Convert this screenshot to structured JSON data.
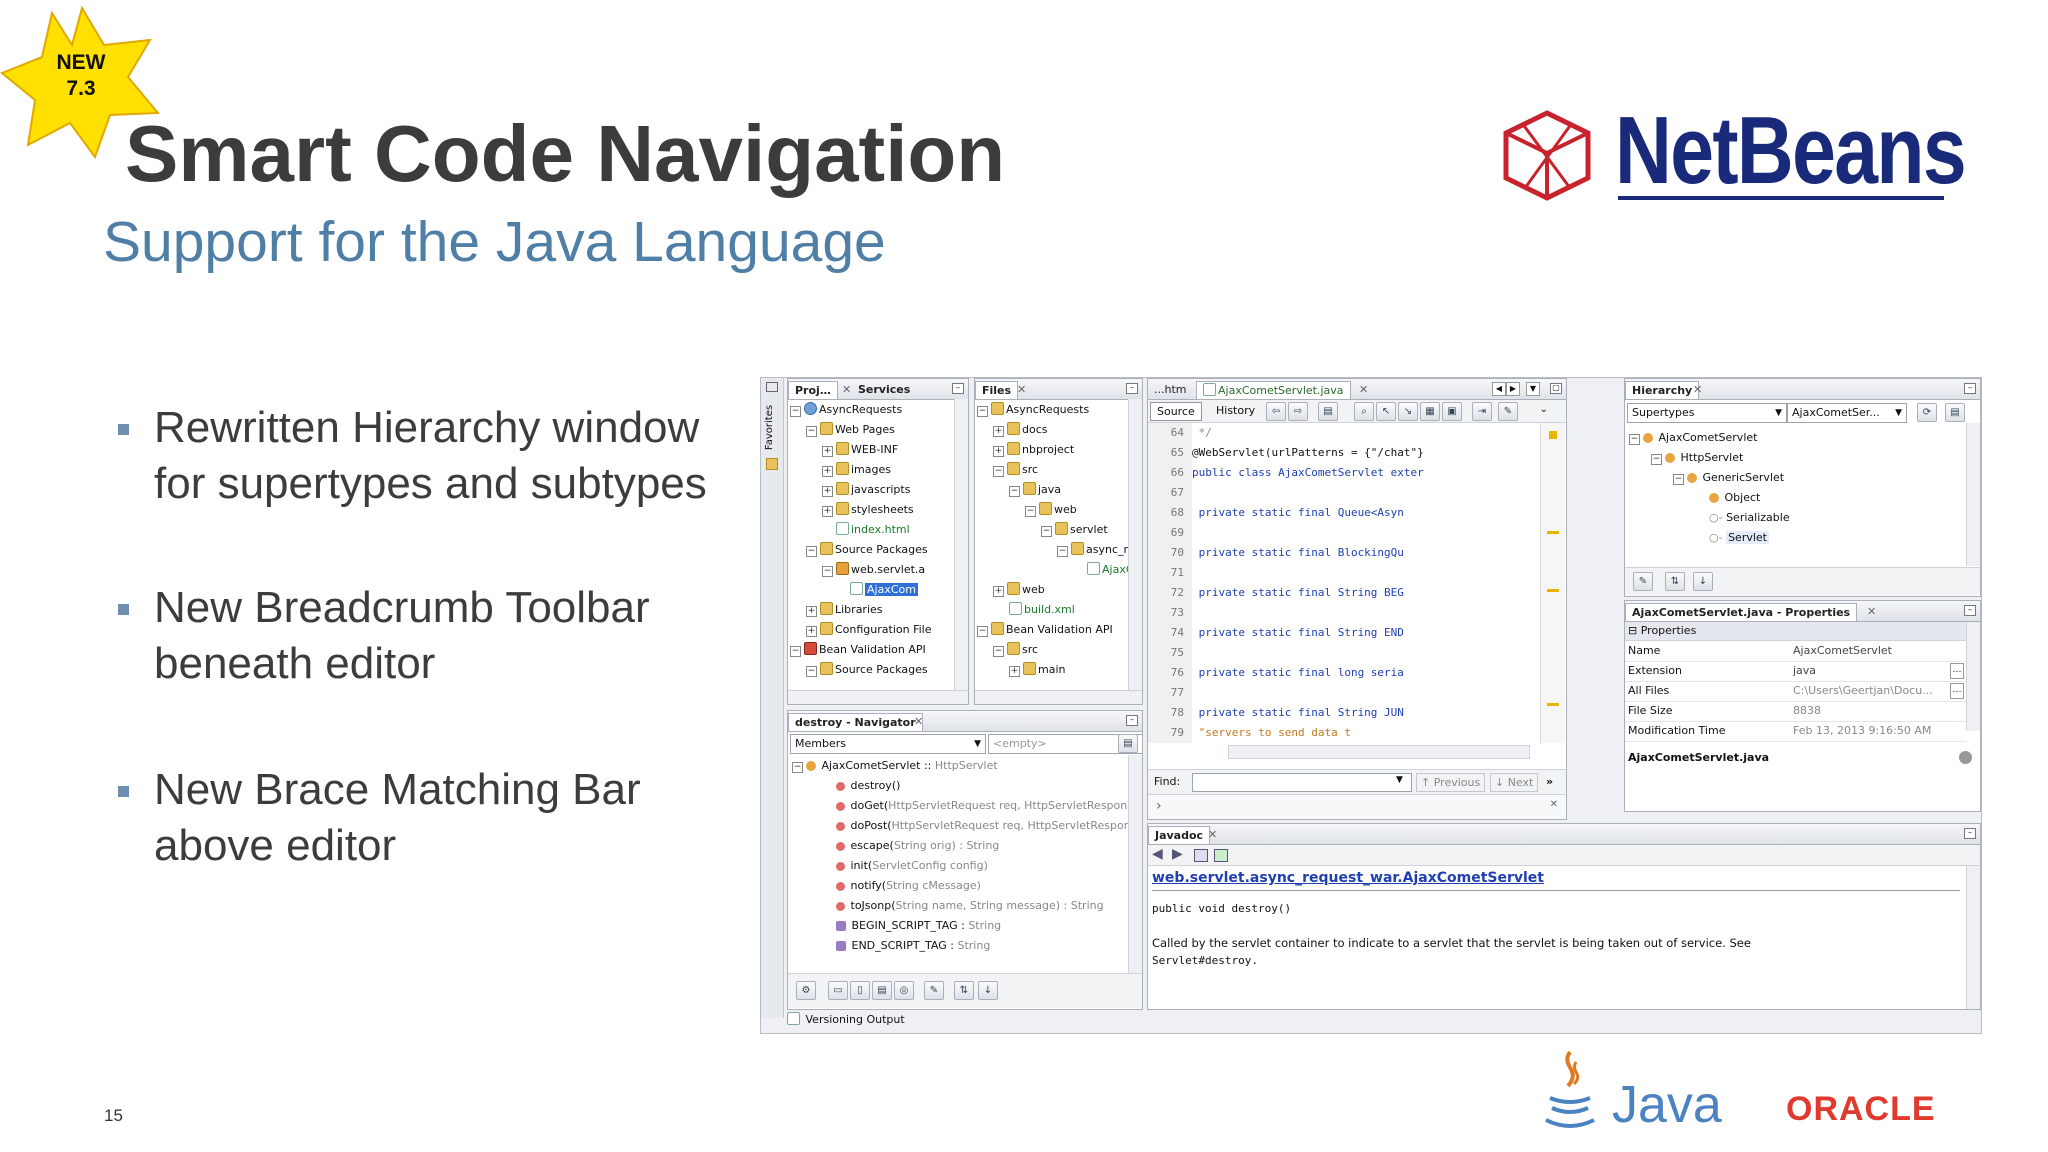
{
  "badge": {
    "line1": "NEW",
    "line2": "7.3"
  },
  "title": "Smart Code Navigation",
  "subtitle": "Support for the Java Language",
  "bullets": [
    {
      "line1": "Rewritten Hierarchy window",
      "line2": "for supertypes and subtypes"
    },
    {
      "line1": "New Breadcrumb Toolbar",
      "line2": "beneath editor"
    },
    {
      "line1": "New Brace Matching Bar",
      "line2": "above editor"
    }
  ],
  "slide_number": "15",
  "logos": {
    "netbeans": "NetBeans",
    "java": "Java",
    "oracle": "ORACLE"
  },
  "colors": {
    "title": "#3c3c3c",
    "subtitle": "#4f7fa6",
    "netbeans": "#1a2a7a",
    "oracle": "#e03a2e",
    "badge": "#ffe000"
  },
  "ide": {
    "side_label": "Favorites",
    "projects": {
      "tab1": "Proj…",
      "tab2": "Services",
      "rows": [
        "AsyncRequests",
        "Web Pages",
        "WEB-INF",
        "images",
        "javascripts",
        "stylesheets",
        "index.html",
        "Source Packages",
        "web.servlet.a",
        "AjaxCom",
        "Libraries",
        "Configuration File",
        "Bean Validation API",
        "Source Packages"
      ]
    },
    "files": {
      "tab": "Files",
      "rows": [
        "AsyncRequests",
        "docs",
        "nbproject",
        "src",
        "java",
        "web",
        "servlet",
        "async_re",
        "AjaxC",
        "web",
        "build.xml",
        "Bean Validation API",
        "src",
        "main"
      ]
    },
    "editor": {
      "tab_prev": "...htm",
      "tab_active": "AjaxCometServlet.java",
      "source_label": "Source",
      "history_label": "History",
      "lines": [
        {
          "n": "64",
          "code": "   */"
        },
        {
          "n": "65",
          "code": "@WebServlet(urlPatterns = {\"/chat\"}"
        },
        {
          "n": "66",
          "code": "public class AjaxCometServlet exter"
        },
        {
          "n": "67",
          "code": ""
        },
        {
          "n": "68",
          "code": "    private static final Queue<Asyn"
        },
        {
          "n": "69",
          "code": ""
        },
        {
          "n": "70",
          "code": "    private static final BlockingQu"
        },
        {
          "n": "71",
          "code": ""
        },
        {
          "n": "72",
          "code": "    private static final String BEG"
        },
        {
          "n": "73",
          "code": ""
        },
        {
          "n": "74",
          "code": "    private static final String END"
        },
        {
          "n": "75",
          "code": ""
        },
        {
          "n": "76",
          "code": "    private static final long seria"
        },
        {
          "n": "77",
          "code": ""
        },
        {
          "n": "78",
          "code": "    private static final String JUN"
        },
        {
          "n": "79",
          "code": "        \"servers to send data t"
        }
      ],
      "find_label": "Find:",
      "previous_label": "Previous",
      "next_label": "Next"
    },
    "hierarchy": {
      "tab": "Hierarchy",
      "mode": "Supertypes",
      "target": "AjaxCometSer...",
      "rows": [
        "AjaxCometServlet",
        "HttpServlet",
        "GenericServlet",
        "Object",
        "Serializable",
        "Servlet"
      ]
    },
    "properties": {
      "tab": "AjaxCometServlet.java - Properties",
      "section": "Properties",
      "rows": [
        {
          "k": "Name",
          "v": "AjaxCometServlet"
        },
        {
          "k": "Extension",
          "v": "java"
        },
        {
          "k": "All Files",
          "v": "C:\\Users\\Geertjan\\Docu..."
        },
        {
          "k": "File Size",
          "v": "8838"
        },
        {
          "k": "Modification Time",
          "v": "Feb 13, 2013 9:16:50 AM"
        }
      ],
      "footer": "AjaxCometServlet.java"
    },
    "navigator": {
      "tab": "destroy - Navigator",
      "members_label": "Members",
      "empty_label": "<empty>",
      "rows": [
        {
          "name": "AjaxCometServlet :: ",
          "type": "HttpServlet"
        },
        {
          "name": "destroy()",
          "type": ""
        },
        {
          "name": "doGet(",
          "type": "HttpServletRequest req, HttpServletResponse res)"
        },
        {
          "name": "doPost(",
          "type": "HttpServletRequest req, HttpServletResponse res)"
        },
        {
          "name": "escape(",
          "type": "String orig) : String"
        },
        {
          "name": "init(",
          "type": "ServletConfig config)"
        },
        {
          "name": "notify(",
          "type": "String cMessage)"
        },
        {
          "name": "toJsonp(",
          "type": "String name, String message) : String"
        },
        {
          "name": "BEGIN_SCRIPT_TAG : ",
          "type": "String"
        },
        {
          "name": "END_SCRIPT_TAG : ",
          "type": "String"
        }
      ]
    },
    "javadoc": {
      "tab": "Javadoc",
      "link": "web.servlet.async_request_war.AjaxCometServlet",
      "signature": "public void destroy()",
      "desc1": "Called by the servlet container to indicate to a servlet that the servlet is being taken out of service. See",
      "desc2": "Servlet#destroy."
    },
    "versioning": "Versioning Output"
  }
}
